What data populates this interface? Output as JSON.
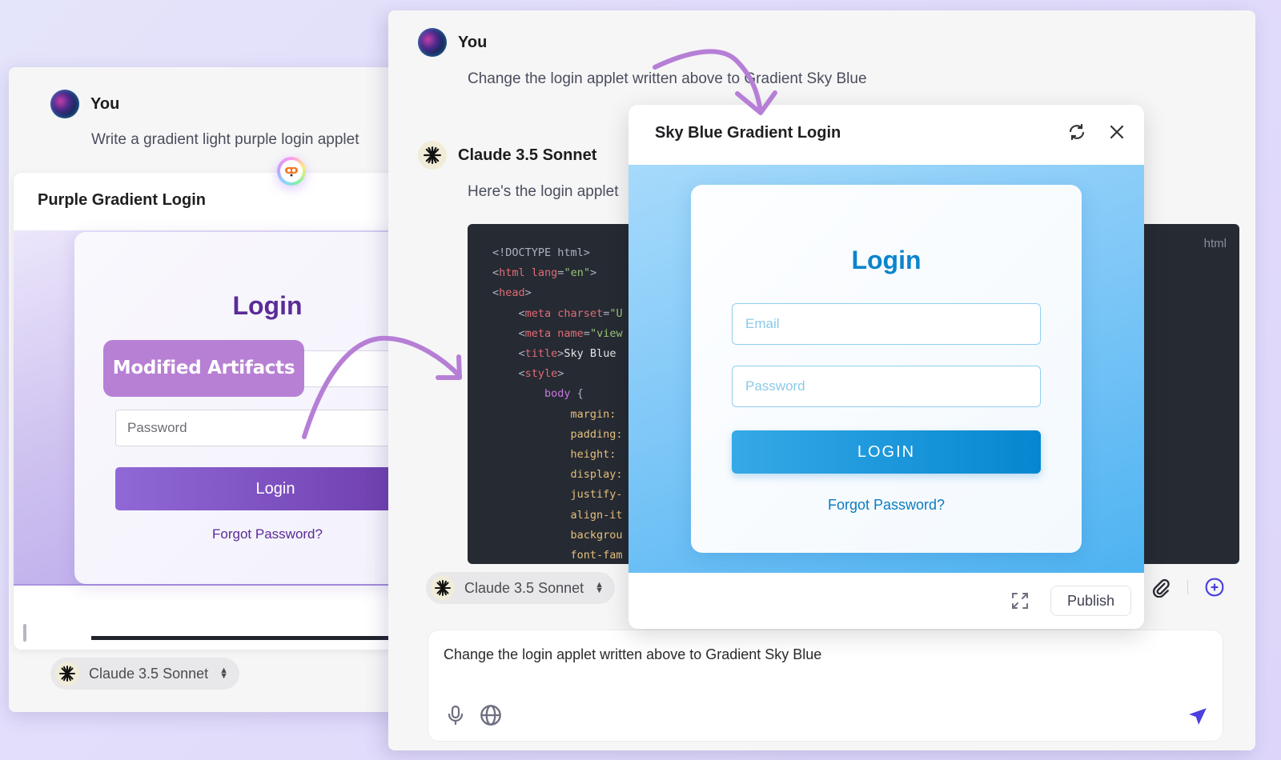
{
  "left_window": {
    "user_name": "You",
    "user_message": "Write a gradient light purple login applet",
    "artifact": {
      "title": "Purple Gradient Login",
      "heading": "Login",
      "password_placeholder": "Password",
      "login_button": "Login",
      "forgot_link": "Forgot Password?"
    },
    "model_selector": "Claude 3.5 Sonnet"
  },
  "annotation": {
    "badge": "Modified Artifacts",
    "accent_color": "#b780d4"
  },
  "right_window": {
    "user_name": "You",
    "user_message": "Change the login applet written above to Gradient Sky Blue",
    "assistant_name": "Claude 3.5 Sonnet",
    "assistant_message": "Here's the login applet",
    "code_block": {
      "language": "html",
      "lines": [
        [
          {
            "t": "doc",
            "v": "<!DOCTYPE html>"
          }
        ],
        [
          {
            "t": "punct",
            "v": "<"
          },
          {
            "t": "tag",
            "v": "html"
          },
          {
            "t": "attr",
            "v": " lang"
          },
          {
            "t": "punct",
            "v": "="
          },
          {
            "t": "str",
            "v": "\"en\""
          },
          {
            "t": "punct",
            "v": ">"
          }
        ],
        [
          {
            "t": "punct",
            "v": "<"
          },
          {
            "t": "tag",
            "v": "head"
          },
          {
            "t": "punct",
            "v": ">"
          }
        ],
        [
          {
            "t": "punct",
            "v": "    <"
          },
          {
            "t": "tag",
            "v": "meta"
          },
          {
            "t": "attr",
            "v": " charset"
          },
          {
            "t": "punct",
            "v": "="
          },
          {
            "t": "str",
            "v": "\"U"
          }
        ],
        [
          {
            "t": "punct",
            "v": "    <"
          },
          {
            "t": "tag",
            "v": "meta"
          },
          {
            "t": "attr",
            "v": " name"
          },
          {
            "t": "punct",
            "v": "="
          },
          {
            "t": "str",
            "v": "\"view"
          }
        ],
        [
          {
            "t": "punct",
            "v": "    <"
          },
          {
            "t": "tag",
            "v": "title"
          },
          {
            "t": "punct",
            "v": ">"
          },
          {
            "t": "text",
            "v": "Sky Blue "
          }
        ],
        [
          {
            "t": "punct",
            "v": "    <"
          },
          {
            "t": "tag",
            "v": "style"
          },
          {
            "t": "punct",
            "v": ">"
          }
        ],
        [
          {
            "t": "sel",
            "v": "        body"
          },
          {
            "t": "punct",
            "v": " {"
          }
        ],
        [
          {
            "t": "prop",
            "v": "            margin: "
          }
        ],
        [
          {
            "t": "prop",
            "v": "            padding:"
          }
        ],
        [
          {
            "t": "prop",
            "v": "            height: "
          }
        ],
        [
          {
            "t": "prop",
            "v": "            display:"
          }
        ],
        [
          {
            "t": "prop",
            "v": "            justify-"
          }
        ],
        [
          {
            "t": "prop",
            "v": "            align-it"
          }
        ],
        [
          {
            "t": "prop",
            "v": "            backgrou"
          }
        ],
        [
          {
            "t": "prop",
            "v": "            font-fam"
          }
        ]
      ]
    },
    "model_selector": "Claude 3.5 Sonnet",
    "composer": {
      "value": "Change the login applet written above to Gradient Sky Blue"
    }
  },
  "sky_artifact": {
    "title": "Sky Blue Gradient Login",
    "heading": "Login",
    "email_placeholder": "Email",
    "password_placeholder": "Password",
    "login_button": "LOGIN",
    "forgot_link": "Forgot Password?",
    "publish_button": "Publish"
  },
  "icons": {
    "refresh": "refresh-icon",
    "close": "close-icon",
    "fullscreen": "fullscreen-icon",
    "attach": "paperclip-icon",
    "new_chat": "plus-circle-icon",
    "mic": "microphone-icon",
    "web": "globe-icon",
    "send": "send-icon"
  },
  "colors": {
    "purple_accent": "#5a2c97",
    "sky_accent": "#0b84cc",
    "send_color": "#4a3fe0"
  }
}
